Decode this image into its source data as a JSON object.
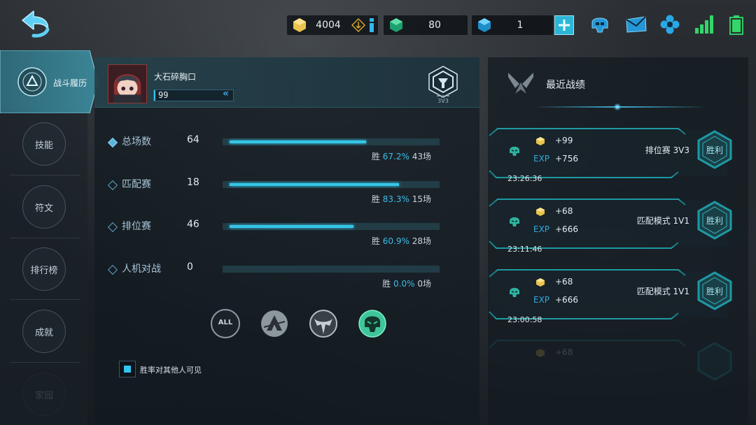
{
  "topbar": {
    "gold": "4004",
    "gems": "80",
    "diamonds": "1",
    "icons": [
      "back-arrow-icon",
      "gold-cube-icon",
      "transfer-icon",
      "info-icon",
      "green-gem-icon",
      "blue-diamond-icon",
      "plus-icon",
      "helmet-icon",
      "mail-icon",
      "settings-flower-icon",
      "signal-icon",
      "battery-icon"
    ]
  },
  "nav": {
    "active": "战斗履历",
    "items": [
      "技能",
      "符文",
      "排行榜",
      "成就",
      "家园"
    ]
  },
  "player": {
    "name": "大石碎胸口",
    "level": "99",
    "mode": "3V3"
  },
  "stats": [
    {
      "label": "总场数",
      "count": "64",
      "win_prefix": "胜",
      "pct": "67.2%",
      "games": "43场",
      "ratio": 0.672
    },
    {
      "label": "匹配赛",
      "count": "18",
      "win_prefix": "胜",
      "pct": "83.3%",
      "games": "15场",
      "ratio": 0.833
    },
    {
      "label": "排位赛",
      "count": "46",
      "win_prefix": "胜",
      "pct": "60.9%",
      "games": "28场",
      "ratio": 0.609
    },
    {
      "label": "人机对战",
      "count": "0",
      "win_prefix": "胜",
      "pct": "0.0%",
      "games": "0场",
      "ratio": 0.0
    }
  ],
  "filters": {
    "all": "ALL"
  },
  "visibility": {
    "label": "胜率对其他人可见"
  },
  "recent": {
    "title": "最近战绩",
    "matches": [
      {
        "gold": "+99",
        "exp_label": "EXP",
        "exp": "+756",
        "mode": "排位赛 3V3",
        "result": "胜利",
        "time": "23:26:36"
      },
      {
        "gold": "+68",
        "exp_label": "EXP",
        "exp": "+666",
        "mode": "匹配模式 1V1",
        "result": "胜利",
        "time": "23:11:46"
      },
      {
        "gold": "+68",
        "exp_label": "EXP",
        "exp": "+666",
        "mode": "匹配模式 1V1",
        "result": "胜利",
        "time": "23:00:58"
      },
      {
        "gold": "+68"
      }
    ]
  },
  "colors": {
    "accent": "#35c7e8",
    "win_teal": "#1f9aa6",
    "gold": "#f2d46a"
  }
}
